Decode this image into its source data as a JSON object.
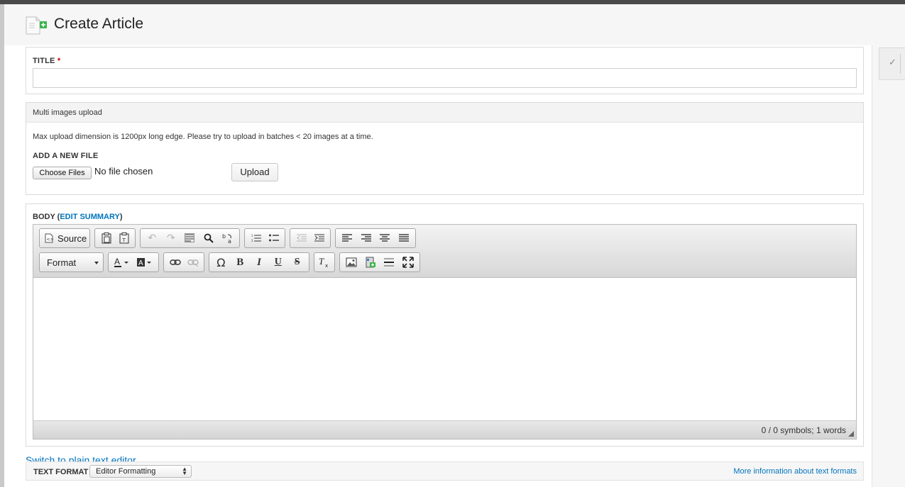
{
  "page": {
    "title": "Create Article"
  },
  "title_field": {
    "label": "TITLE",
    "required_mark": "*",
    "value": ""
  },
  "multi_upload": {
    "legend": "Multi images upload",
    "description": "Max upload dimension is 1200px long edge. Please try to upload in batches < 20 images at a time.",
    "add_label": "ADD A NEW FILE",
    "choose_label": "Choose Files",
    "no_file_text": "No file chosen",
    "upload_label": "Upload"
  },
  "body": {
    "label": "BODY",
    "edit_summary": "EDIT SUMMARY",
    "toolbar": {
      "source_label": "Source",
      "format_label": "Format"
    },
    "word_count": "0 / 0 symbols; 1 words"
  },
  "switch_link": "Switch to plain text editor",
  "text_format": {
    "label": "TEXT FORMAT",
    "selected": "Editor Formatting",
    "more_info": "More information about text formats"
  },
  "icons": [
    "page-add-icon",
    "source-icon",
    "paste-icon",
    "paste-text-icon",
    "undo-icon",
    "redo-icon",
    "select-all-icon",
    "find-icon",
    "replace-icon",
    "numbered-list-icon",
    "bulleted-list-icon",
    "outdent-icon",
    "indent-icon",
    "align-left-icon",
    "align-right-icon",
    "align-center-icon",
    "justify-icon",
    "text-color-icon",
    "background-color-icon",
    "link-icon",
    "unlink-icon",
    "special-char-icon",
    "bold-icon",
    "italic-icon",
    "underline-icon",
    "strikethrough-icon",
    "remove-format-icon",
    "image-icon",
    "media-icon",
    "horizontal-rule-icon",
    "maximize-icon",
    "checkmark-icon"
  ]
}
